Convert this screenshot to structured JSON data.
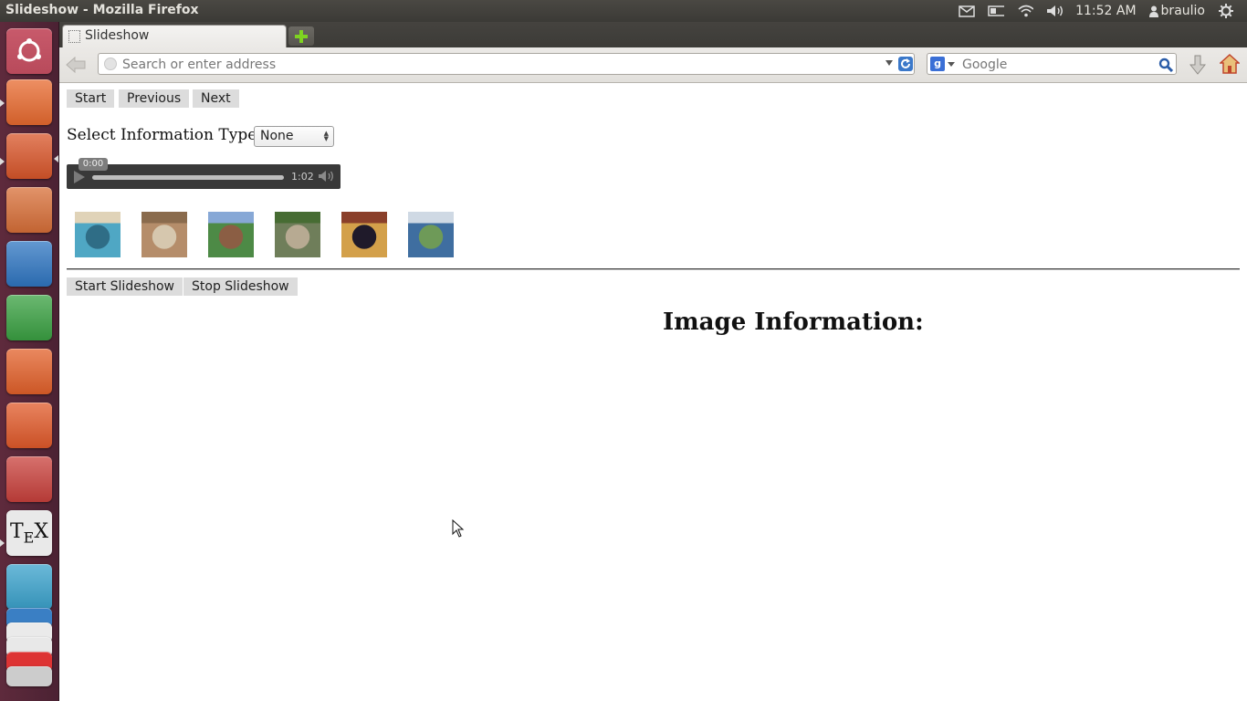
{
  "window": {
    "title": "Slideshow - Mozilla Firefox"
  },
  "tray": {
    "clock": "11:52 AM",
    "user": "braulio"
  },
  "launcher": {
    "items": [
      {
        "name": "ubuntu-dash-icon",
        "color": "#b84a5b"
      },
      {
        "name": "files-icon",
        "color": "#e86a2f"
      },
      {
        "name": "firefox-icon",
        "color": "#d9562a"
      },
      {
        "name": "impress-icon",
        "color": "#d86f38"
      },
      {
        "name": "writer-icon",
        "color": "#2f76c2"
      },
      {
        "name": "calc-icon",
        "color": "#3aa142"
      },
      {
        "name": "software-center-icon",
        "color": "#e3612a"
      },
      {
        "name": "ubuntu-one-icon",
        "color": "#e15a2a"
      },
      {
        "name": "system-settings-icon",
        "color": "#c9413c"
      },
      {
        "name": "texmaker-icon",
        "color": "#e9e9e9"
      },
      {
        "name": "workspace-switcher-icon",
        "color": "#3aa2cc"
      }
    ]
  },
  "browser": {
    "tab_label": "Slideshow",
    "url_placeholder": "Search or enter address",
    "search_placeholder": "Google",
    "search_engine_letter": "g"
  },
  "page": {
    "nav": {
      "start": "Start",
      "previous": "Previous",
      "next": "Next"
    },
    "info_type": {
      "label": "Select Information Type:",
      "selected": "None"
    },
    "audio": {
      "current_time": "0:00",
      "duration": "1:02"
    },
    "thumbnails": [
      {
        "name": "thumbnail-pool",
        "colors": [
          "#4fa7c4",
          "#2f6d86",
          "#e0d3b8"
        ]
      },
      {
        "name": "thumbnail-arena-interior",
        "colors": [
          "#b58d6a",
          "#d6c7ae",
          "#8a6b4d"
        ]
      },
      {
        "name": "thumbnail-stadium-field",
        "colors": [
          "#4d8a46",
          "#8b5e44",
          "#87a8d6"
        ]
      },
      {
        "name": "thumbnail-stadium-aerial",
        "colors": [
          "#6f7e5a",
          "#b7aa92",
          "#476c33"
        ]
      },
      {
        "name": "thumbnail-basketball-court",
        "colors": [
          "#d3a04a",
          "#1f1a2a",
          "#8a3f2a"
        ]
      },
      {
        "name": "thumbnail-tennis-courts",
        "colors": [
          "#3f6ea0",
          "#6e9a58",
          "#cfd9e4"
        ]
      }
    ],
    "slideshow": {
      "start": "Start Slideshow",
      "stop": "Stop Slideshow"
    },
    "image_info_heading": "Image Information:"
  }
}
